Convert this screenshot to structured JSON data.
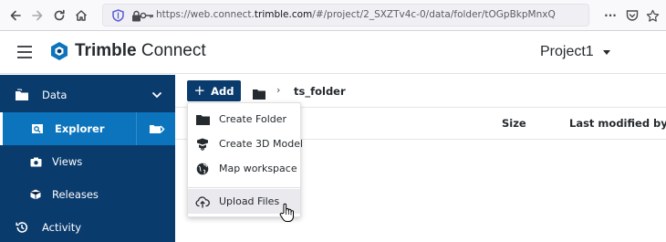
{
  "browser": {
    "url_prefix": "https://web.connect.",
    "url_domain": "trimble.com",
    "url_suffix": "/#/project/2_SXZTv4c-0/data/folder/tOGpBkpMnxQ",
    "more_icon": "···"
  },
  "header": {
    "brand_bold": "Trimble",
    "brand_light": " Connect",
    "project_name": "Project1"
  },
  "sidebar": {
    "items": [
      {
        "label": "Data",
        "icon": "folder-stack-icon"
      },
      {
        "label": "Explorer",
        "icon": "explorer-icon"
      },
      {
        "label": "Views",
        "icon": "camera-icon"
      },
      {
        "label": "Releases",
        "icon": "cube-icon"
      },
      {
        "label": "Activity",
        "icon": "history-icon"
      }
    ]
  },
  "toolbar": {
    "add_label": "Add",
    "breadcrumb_sep": "›",
    "current_folder": "ts_folder"
  },
  "table": {
    "columns": [
      "Size",
      "Last modified by"
    ]
  },
  "add_menu": {
    "items": [
      {
        "label": "Create Folder",
        "icon": "folder-icon"
      },
      {
        "label": "Create 3D Model",
        "icon": "model-3d-icon"
      },
      {
        "label": "Map workspace",
        "icon": "globe-icon"
      },
      {
        "label": "Upload Files",
        "icon": "cloud-upload-icon"
      }
    ]
  },
  "colors": {
    "sidebar_bg": "#0a3b6d",
    "sidebar_active": "#0b74bd",
    "add_button": "#0a3b6d"
  }
}
